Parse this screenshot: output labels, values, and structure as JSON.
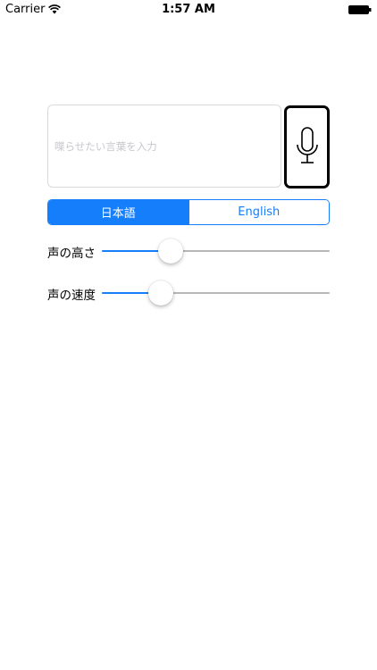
{
  "status_bar": {
    "carrier": "Carrier",
    "time": "1:57 AM",
    "wifi_icon": "wifi-icon",
    "battery_icon": "battery-icon"
  },
  "input": {
    "placeholder": "喋らせたい言葉を入力",
    "value": ""
  },
  "mic_button": {
    "icon": "microphone-icon"
  },
  "language_selector": {
    "options": [
      "日本語",
      "English"
    ],
    "selected": "日本語"
  },
  "sliders": [
    {
      "label": "声の高さ",
      "value": 0.3
    },
    {
      "label": "声の速度",
      "value": 0.26
    }
  ],
  "colors": {
    "accent": "#157efb",
    "track": "#b7b7b7",
    "placeholder": "#c7c7cd"
  }
}
